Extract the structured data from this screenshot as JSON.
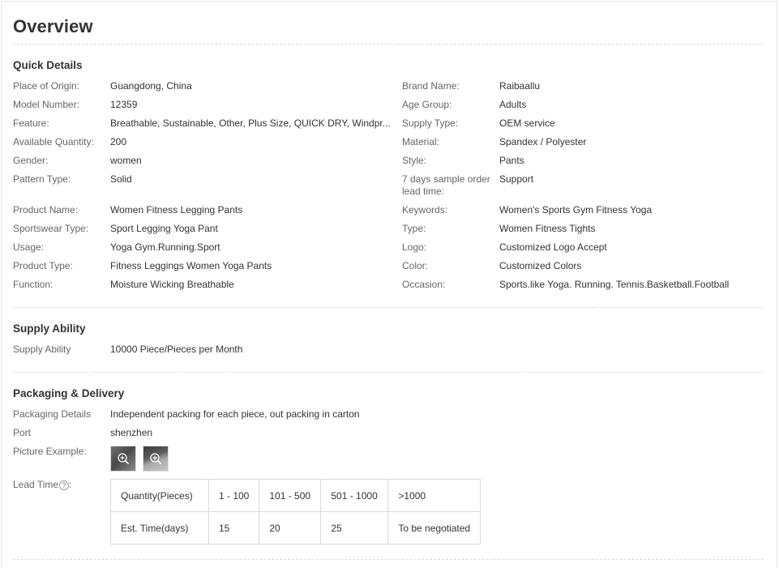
{
  "page_title": "Overview",
  "quick_details": {
    "heading": "Quick Details",
    "left": [
      {
        "label": "Place of Origin:",
        "value": "Guangdong, China"
      },
      {
        "label": "Model Number:",
        "value": "12359"
      },
      {
        "label": "Feature:",
        "value": "Breathable, Sustainable, Other, Plus Size, QUICK DRY, Windpr..."
      },
      {
        "label": "Available Quantity:",
        "value": "200"
      },
      {
        "label": "Gender:",
        "value": "women"
      },
      {
        "label": "Pattern Type:",
        "value": "Solid"
      },
      {
        "label": "Product Name:",
        "value": "Women Fitness Legging Pants"
      },
      {
        "label": "Sportswear Type:",
        "value": "Sport Legging Yoga Pant"
      },
      {
        "label": "Usage:",
        "value": "Yoga Gym.Running.Sport"
      },
      {
        "label": "Product Type:",
        "value": "Fitness Leggings Women Yoga Pants"
      },
      {
        "label": "Function:",
        "value": "Moisture Wicking Breathable"
      }
    ],
    "right": [
      {
        "label": "Brand Name:",
        "value": "Raibaallu"
      },
      {
        "label": "Age Group:",
        "value": "Adults"
      },
      {
        "label": "Supply Type:",
        "value": "OEM service"
      },
      {
        "label": "Material:",
        "value": "Spandex / Polyester"
      },
      {
        "label": "Style:",
        "value": "Pants"
      },
      {
        "label": "7 days sample order lead time:",
        "value": "Support"
      },
      {
        "label": "Keywords:",
        "value": "Women's Sports Gym Fitness Yoga"
      },
      {
        "label": "Type:",
        "value": "Women Fitness Tights"
      },
      {
        "label": "Logo:",
        "value": "Customized Logo Accept"
      },
      {
        "label": "Color:",
        "value": "Customized Colors"
      },
      {
        "label": "Occasion:",
        "value": "Sports.like Yoga. Running. Tennis.Basketball.Football"
      }
    ]
  },
  "supply_ability": {
    "heading": "Supply Ability",
    "label": "Supply Ability",
    "value": "10000 Piece/Pieces per Month"
  },
  "packaging": {
    "heading": "Packaging & Delivery",
    "details_label": "Packaging Details",
    "details_value": "Independent packing for each piece, out packing in carton",
    "port_label": "Port",
    "port_value": "shenzhen",
    "picture_label": "Picture Example:",
    "zoom_icon": "magnifier-plus-icon",
    "lead_time_label": "Lead Time",
    "help_icon": "?",
    "lead_table": {
      "row1": [
        "Quantity(Pieces)",
        "1 - 100",
        "101 - 500",
        "501 - 1000",
        ">1000"
      ],
      "row2": [
        "Est. Time(days)",
        "15",
        "20",
        "25",
        "To be negotiated"
      ]
    }
  }
}
